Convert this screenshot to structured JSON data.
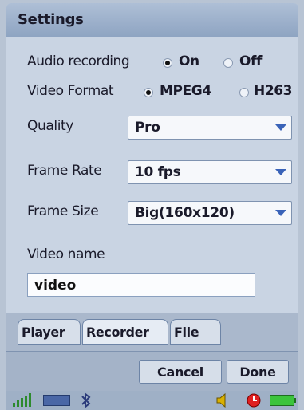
{
  "window": {
    "title": "Settings"
  },
  "audio": {
    "label": "Audio recording",
    "options": [
      "On",
      "Off"
    ],
    "selected": "On"
  },
  "video_format": {
    "label": "Video Format",
    "options": [
      "MPEG4",
      "H263"
    ],
    "selected": "MPEG4"
  },
  "quality": {
    "label": "Quality",
    "value": "Pro"
  },
  "frame_rate": {
    "label": "Frame Rate",
    "value": "10 fps"
  },
  "frame_size": {
    "label": "Frame Size",
    "value": "Big(160x120)"
  },
  "video_name": {
    "label": "Video name",
    "value": "video"
  },
  "tabs": [
    {
      "label": "Player",
      "active": false
    },
    {
      "label": "Recorder",
      "active": true
    },
    {
      "label": "File",
      "active": false
    }
  ],
  "buttons": {
    "cancel": "Cancel",
    "done": "Done"
  },
  "status_icons": [
    "signal-strength-icon",
    "keyboard-icon",
    "bluetooth-icon",
    "speaker-icon",
    "alarm-clock-icon",
    "battery-icon"
  ],
  "colors": {
    "accent": "#3a63b8",
    "title_bar": "#9fb3cf",
    "background": "#c9d4e3",
    "battery": "#3cc43c"
  }
}
